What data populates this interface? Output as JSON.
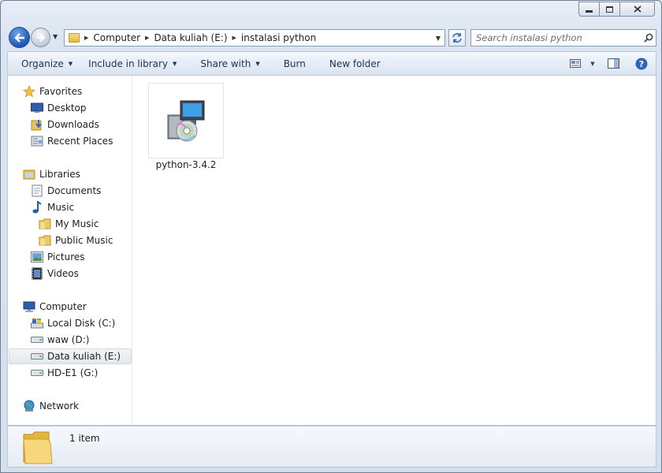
{
  "window": {
    "caption": {
      "minimize": "▭",
      "maximize": "▢",
      "close": "✕"
    }
  },
  "navbar": {
    "breadcrumbs": [
      "Computer",
      "Data kuliah (E:)",
      "instalasi python"
    ],
    "search_placeholder": "Search instalasi python"
  },
  "toolbar": {
    "organize": "Organize",
    "include_in_library": "Include in library",
    "share_with": "Share with",
    "burn": "Burn",
    "new_folder": "New folder"
  },
  "sidebar": {
    "favorites": {
      "label": "Favorites",
      "items": [
        {
          "label": "Desktop",
          "icon": "desktop-icon"
        },
        {
          "label": "Downloads",
          "icon": "downloads-icon"
        },
        {
          "label": "Recent Places",
          "icon": "recent-places-icon"
        }
      ]
    },
    "libraries": {
      "label": "Libraries",
      "items": [
        {
          "label": "Documents",
          "icon": "documents-icon"
        },
        {
          "label": "Music",
          "icon": "music-icon"
        },
        {
          "label": "My Music",
          "icon": "folder-icon"
        },
        {
          "label": "Public Music",
          "icon": "folder-icon"
        },
        {
          "label": "Pictures",
          "icon": "pictures-icon"
        },
        {
          "label": "Videos",
          "icon": "videos-icon"
        }
      ]
    },
    "computer": {
      "label": "Computer",
      "items": [
        {
          "label": "Local Disk (C:)",
          "icon": "local-disk-icon"
        },
        {
          "label": "waw (D:)",
          "icon": "drive-icon"
        },
        {
          "label": "Data kuliah (E:)",
          "icon": "drive-icon",
          "selected": true
        },
        {
          "label": "HD-E1 (G:)",
          "icon": "drive-icon"
        }
      ]
    },
    "network": {
      "label": "Network"
    }
  },
  "files": [
    {
      "name": "python-3.4.2",
      "icon": "installer-icon"
    }
  ],
  "details": {
    "count": "1 item"
  },
  "colors": {
    "accent": "#2b64b8",
    "selection": "#e4e8ee",
    "folder": "#e4b63d"
  }
}
